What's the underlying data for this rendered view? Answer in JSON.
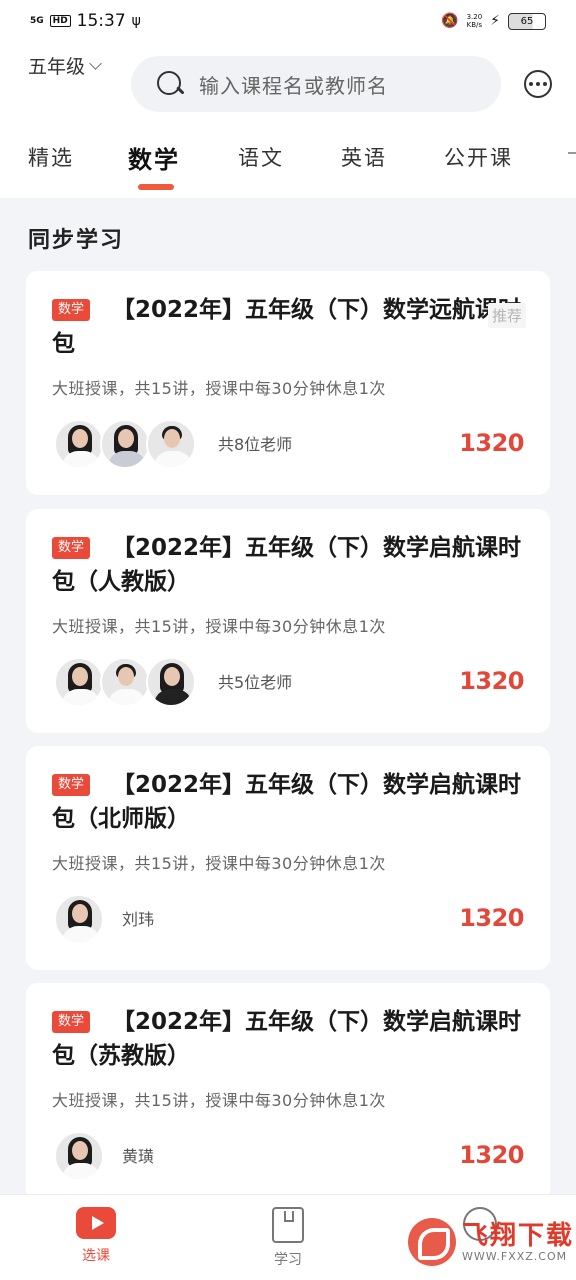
{
  "status_bar": {
    "network": "5G",
    "hd": "HD",
    "time": "15:37",
    "speed_value": "3.20",
    "speed_unit": "KB/s",
    "battery": "65"
  },
  "header": {
    "grade": "五年级",
    "search_placeholder": "输入课程名或教师名"
  },
  "tabs": [
    {
      "label": "精选",
      "active": false
    },
    {
      "label": "数学",
      "active": true
    },
    {
      "label": "语文",
      "active": false
    },
    {
      "label": "英语",
      "active": false
    },
    {
      "label": "公开课",
      "active": false
    }
  ],
  "section_title": "同步学习",
  "courses": [
    {
      "tag": "数学",
      "title": "【2022年】五年级（下）数学远航课时包",
      "badge": "推荐",
      "desc": "大班授课，共15讲，授课中每30分钟休息1次",
      "teachers_text": "共8位老师",
      "price": "1320"
    },
    {
      "tag": "数学",
      "title": "【2022年】五年级（下）数学启航课时包（人教版）",
      "desc": "大班授课，共15讲，授课中每30分钟休息1次",
      "teachers_text": "共5位老师",
      "price": "1320"
    },
    {
      "tag": "数学",
      "title": "【2022年】五年级（下）数学启航课时包（北师版）",
      "desc": "大班授课，共15讲，授课中每30分钟休息1次",
      "teachers_text": "刘玮",
      "price": "1320"
    },
    {
      "tag": "数学",
      "title": "【2022年】五年级（下）数学启航课时包（苏教版）",
      "desc": "大班授课，共15讲，授课中每30分钟休息1次",
      "teachers_text": "黄璜",
      "price": "1320"
    }
  ],
  "bottom_nav": [
    {
      "label": "选课",
      "icon": "play-icon",
      "active": true
    },
    {
      "label": "学习",
      "icon": "book-icon",
      "active": false
    },
    {
      "label": "",
      "icon": "profile-icon",
      "active": false
    }
  ],
  "watermark": {
    "main": "飞翔下载",
    "sub": "WWW.FXXZ.COM"
  },
  "colors": {
    "accent": "#ea4a3a",
    "price": "#e2483a",
    "tab_underline": "#ef5a3c",
    "background": "#f3f4f8"
  }
}
